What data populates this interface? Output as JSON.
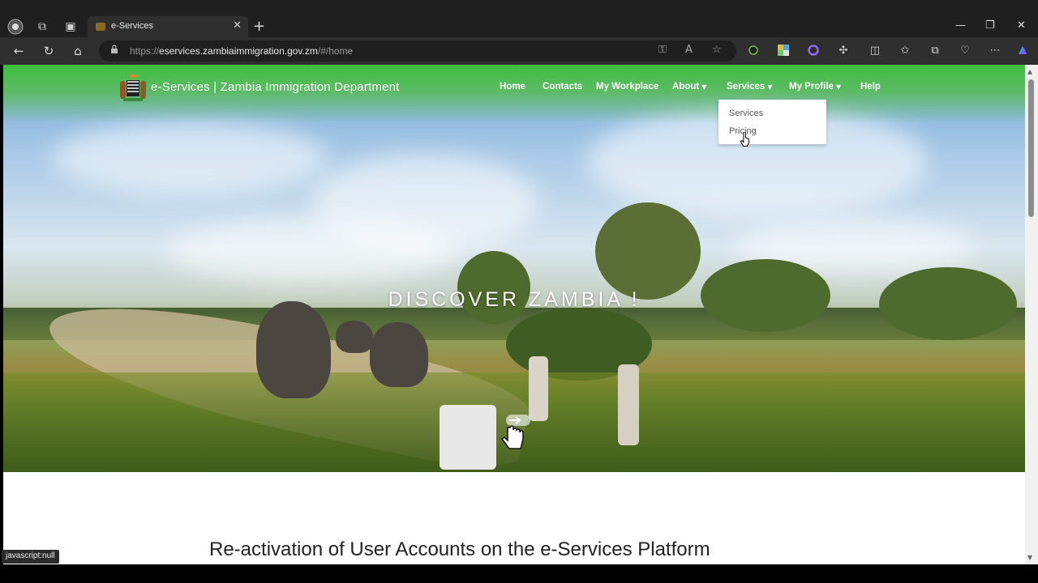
{
  "browser": {
    "tab_title": "e-Services",
    "url_prefix": "https://",
    "url_host": "eservices.zambiaimmigration.gov.zm",
    "url_path": "/#/home",
    "status_text": "javascript:null"
  },
  "site": {
    "title": "e-Services | Zambia Immigration Department",
    "menu": {
      "home": "Home",
      "contacts": "Contacts",
      "workplace": "My Workplace",
      "about": "About",
      "services": "Services",
      "profile": "My Profile",
      "help": "Help"
    },
    "services_dropdown": [
      "Services",
      "Pricing"
    ]
  },
  "hero": {
    "headline": "DISCOVER ZAMBIA !"
  },
  "content": {
    "section_title": "Re-activation of User Accounts on the e-Services Platform"
  }
}
